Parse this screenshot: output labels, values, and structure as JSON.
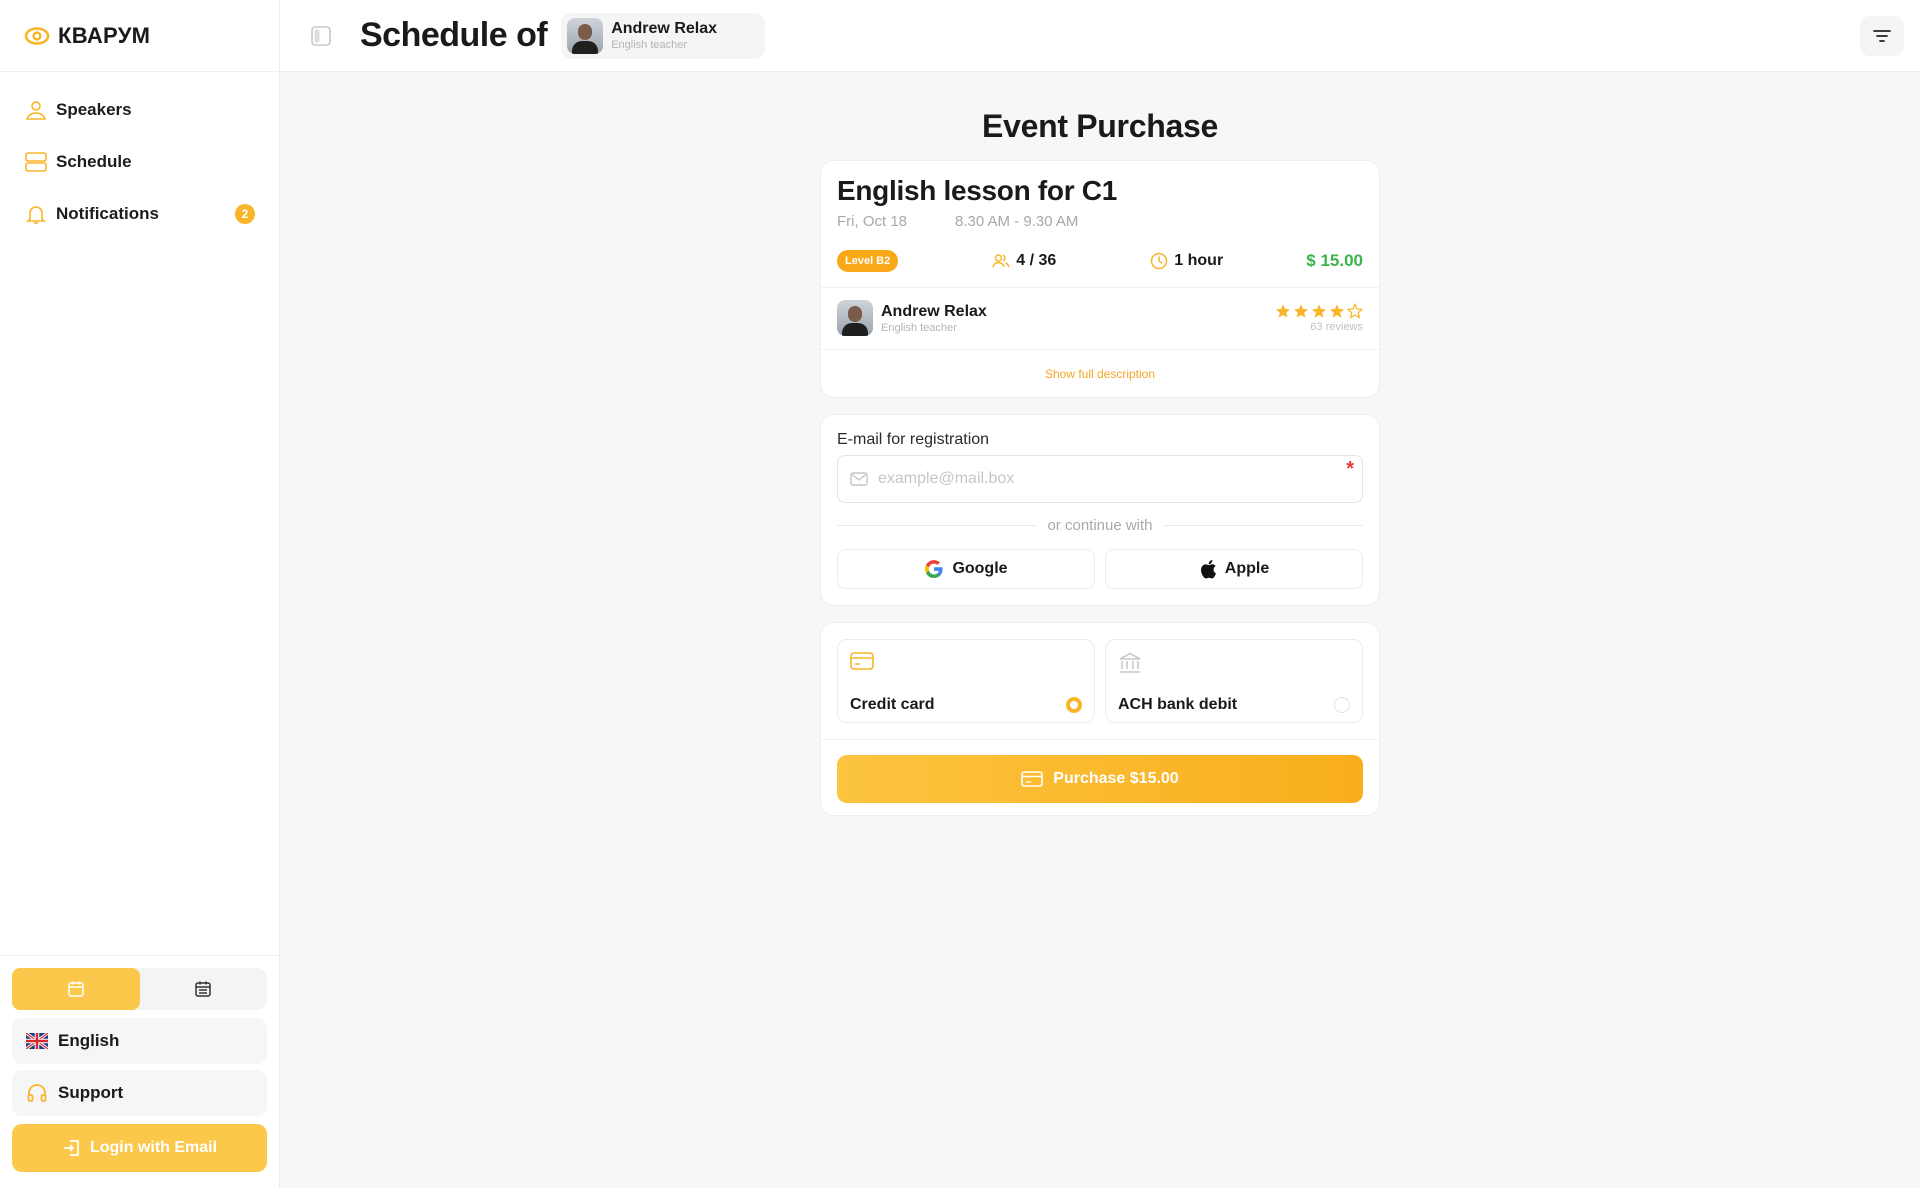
{
  "brand": {
    "name": "КВАРУМ",
    "accent": "#f9b529"
  },
  "sidebar": {
    "items": [
      {
        "label": "Speakers",
        "icon": "user-icon"
      },
      {
        "label": "Schedule",
        "icon": "schedule-icon"
      },
      {
        "label": "Notifications",
        "icon": "bell-icon",
        "badge": "2"
      }
    ],
    "language": "English",
    "support": "Support",
    "login": "Login with Email"
  },
  "header": {
    "title": "Schedule of",
    "teacher_name": "Andrew Relax",
    "teacher_role": "English teacher"
  },
  "main": {
    "title": "Event Purchase",
    "event": {
      "title": "English lesson for C1",
      "date": "Fri, Oct 18",
      "time": "8.30 AM - 9.30 AM",
      "level": "Level B2",
      "participants": "4 / 36",
      "duration": "1 hour",
      "price": "$ 15.00",
      "teacher_name": "Andrew Relax",
      "teacher_role": "English teacher",
      "rating": 4,
      "rating_max": 5,
      "reviews": "63 reviews",
      "show_description": "Show full description"
    },
    "registration": {
      "label": "E-mail for registration",
      "placeholder": "example@mail.box",
      "required_mark": "*",
      "or_text": "or continue with",
      "google": "Google",
      "apple": "Apple"
    },
    "payment": {
      "options": [
        {
          "label": "Credit card",
          "selected": true
        },
        {
          "label": "ACH bank debit",
          "selected": false
        }
      ],
      "purchase": "Purchase $15.00"
    }
  }
}
